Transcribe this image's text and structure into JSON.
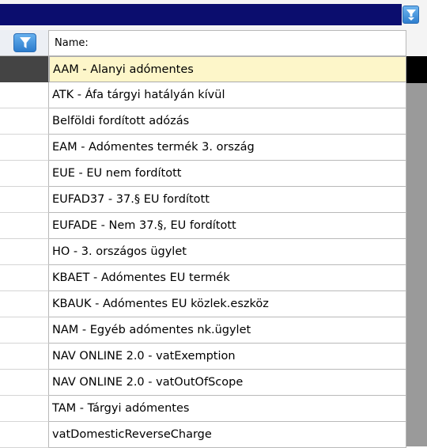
{
  "header": {
    "column_name": "Name:",
    "filter_icon": "filter-icon",
    "dropdown_icon": "filter-dropdown-icon"
  },
  "colors": {
    "title_band": "#0b0d6e",
    "selected_row": "#fdf6c9",
    "button_blue": "#2f7fcf"
  },
  "rows": [
    {
      "label": "AAM - Alanyi adómentes"
    },
    {
      "label": "ATK - Áfa tárgyi hatályán kívül"
    },
    {
      "label": "Belföldi fordított adózás"
    },
    {
      "label": "EAM - Adómentes termék 3. ország"
    },
    {
      "label": "EUE - EU nem fordított"
    },
    {
      "label": "EUFAD37 - 37.§ EU fordított"
    },
    {
      "label": "EUFADE - Nem 37.§, EU fordított"
    },
    {
      "label": "HO - 3. országos ügylet"
    },
    {
      "label": "KBAET - Adómentes EU termék"
    },
    {
      "label": "KBAUK - Adómentes EU közlek.eszköz"
    },
    {
      "label": "NAM - Egyéb adómentes nk.ügylet"
    },
    {
      "label": "NAV ONLINE 2.0 - vatExemption"
    },
    {
      "label": "NAV ONLINE 2.0 - vatOutOfScope"
    },
    {
      "label": "TAM - Tárgyi adómentes"
    },
    {
      "label": "vatDomesticReverseCharge"
    }
  ]
}
